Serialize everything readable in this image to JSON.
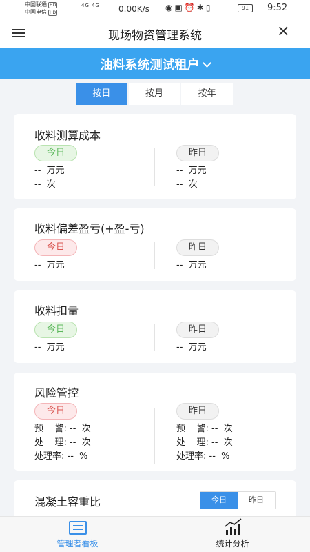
{
  "status_bar": {
    "carrier1": "中国联通",
    "carrier2": "中国电信",
    "hd": "HD",
    "network": "4G 4G",
    "speed": "0.00K/s",
    "battery": "91",
    "time": "9:52"
  },
  "header": {
    "title": "现场物资管理系统"
  },
  "tenant": {
    "name": "油料系统测试租户"
  },
  "period_tabs": [
    "按日",
    "按月",
    "按年"
  ],
  "cards": {
    "cost": {
      "title": "收料测算成本",
      "today": "今日",
      "yesterday": "昨日",
      "today_amount": "--  万元",
      "today_count": "--  次",
      "yesterday_amount": "--  万元",
      "yesterday_count": "--  次"
    },
    "deviation": {
      "title": "收料偏差盈亏(+盈-亏)",
      "today": "今日",
      "yesterday": "昨日",
      "today_amount": "--  万元",
      "yesterday_amount": "--  万元"
    },
    "deduction": {
      "title": "收料扣量",
      "today": "今日",
      "yesterday": "昨日",
      "today_amount": "--  万元",
      "yesterday_amount": "--  万元"
    },
    "risk": {
      "title": "风险管控",
      "today": "今日",
      "yesterday": "昨日",
      "today_warning": "预    警: --  次",
      "today_handled": "处    理: --  次",
      "today_rate": "处理率: --  %",
      "yesterday_warning": "预    警: --  次",
      "yesterday_handled": "处    理: --  次",
      "yesterday_rate": "处理率: --  %"
    },
    "concrete": {
      "title": "混凝土容重比",
      "today": "今日",
      "yesterday": "昨日"
    }
  },
  "bottom_nav": {
    "dashboard": "管理者看板",
    "stats": "统计分析"
  },
  "colors": {
    "primary": "#3a90e8",
    "tenant_bar": "#3aa4f0",
    "green": "#5cb85c",
    "red": "#d9534f"
  }
}
